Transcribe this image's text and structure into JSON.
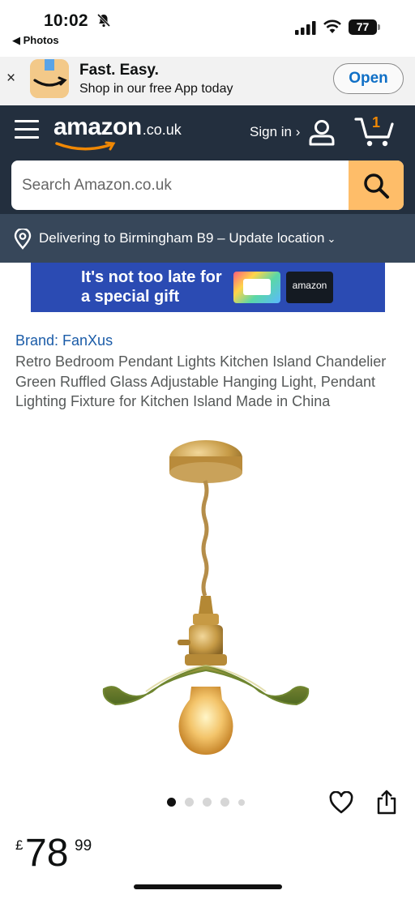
{
  "status_bar": {
    "time": "10:02",
    "back_label": "◀ Photos",
    "battery": "77"
  },
  "app_banner": {
    "close_glyph": "×",
    "title": "Fast. Easy.",
    "subtitle": "Shop in our free App today",
    "open_label": "Open"
  },
  "header": {
    "logo_word": "amazon",
    "logo_tld": ".co.uk",
    "signin_label": "Sign in ›",
    "cart_count": "1"
  },
  "search": {
    "placeholder": "Search Amazon.co.uk"
  },
  "location": {
    "text": "Delivering to Birmingham B9 – Update location",
    "chevron": "⌄"
  },
  "promo": {
    "line1": "It's not too late for",
    "line2": "a special gift",
    "chip_label": "amazon"
  },
  "product": {
    "brand": "Brand: FanXus",
    "title": "Retro Bedroom Pendant Lights Kitchen Island Chandelier Green Ruffled Glass Adjustable Hanging Light, Pendant Lighting Fixture for Kitchen Island Made in China",
    "image_count": 5,
    "active_image": 1
  },
  "price": {
    "currency": "£",
    "whole": "78",
    "fraction": "99"
  },
  "colors": {
    "header_bg": "#232f3e",
    "location_bg": "#37475a",
    "search_button": "#febd69",
    "cart_count": "#f08804",
    "brand_link": "#1b5ca8",
    "open_button_text": "#0f6fc6"
  },
  "icons": [
    "bell-slash-icon",
    "signal-icon",
    "wifi-icon",
    "battery-icon",
    "close-icon",
    "amazon-app-icon",
    "hamburger-icon",
    "user-icon",
    "cart-icon",
    "search-icon",
    "location-pin-icon",
    "heart-icon",
    "share-icon"
  ]
}
